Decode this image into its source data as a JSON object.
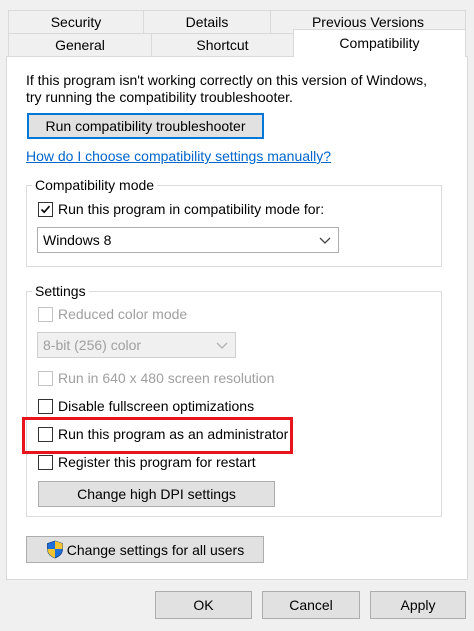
{
  "tabs_back": [
    "Security",
    "Details",
    "Previous Versions"
  ],
  "tabs_front": [
    "General",
    "Shortcut",
    "Compatibility"
  ],
  "intro_text": "If this program isn't working correctly on this version of Windows, try running the compatibility troubleshooter.",
  "troubleshooter_button": "Run compatibility troubleshooter",
  "help_link": "How do I choose compatibility settings manually?",
  "compat_mode": {
    "legend": "Compatibility mode",
    "checkbox_label": "Run this program in compatibility mode for:",
    "checked": true,
    "selected_os": "Windows 8"
  },
  "settings": {
    "legend": "Settings",
    "reduced_color": {
      "label": "Reduced color mode",
      "checked": false,
      "enabled": false
    },
    "color_combo": "8-bit (256) color",
    "resolution": {
      "label": "Run in 640 x 480 screen resolution",
      "checked": false,
      "enabled": false
    },
    "fullscreen": {
      "label": "Disable fullscreen optimizations",
      "checked": false,
      "enabled": true
    },
    "admin": {
      "label": "Run this program as an administrator",
      "checked": false,
      "enabled": true
    },
    "restart": {
      "label": "Register this program for restart",
      "checked": false,
      "enabled": true
    },
    "dpi_button": "Change high DPI settings"
  },
  "all_users_button": "Change settings for all users",
  "footer": {
    "ok": "OK",
    "cancel": "Cancel",
    "apply": "Apply"
  },
  "colors": {
    "accent": "#0078d7",
    "highlight": "#e8141c",
    "link": "#0066cc"
  },
  "icons": {
    "shield": "uac-shield-icon"
  }
}
